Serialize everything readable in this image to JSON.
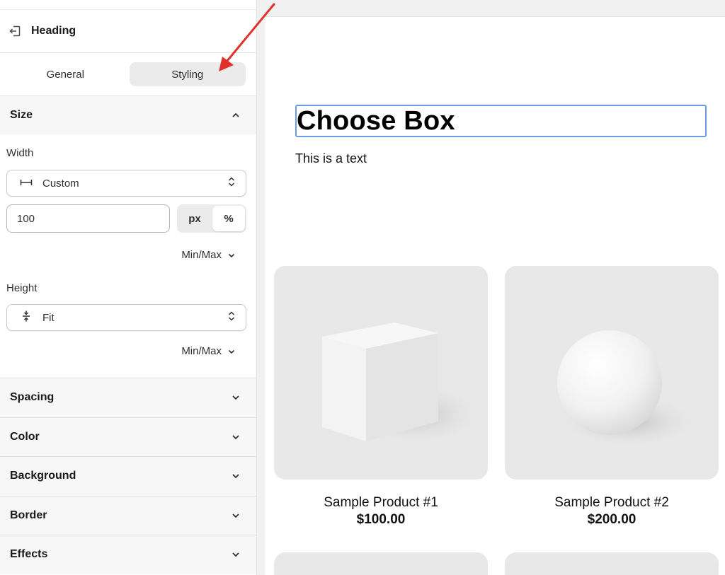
{
  "panel": {
    "title": "Heading",
    "tabs": [
      {
        "label": "General",
        "active": false
      },
      {
        "label": "Styling",
        "active": true
      }
    ],
    "size_section": {
      "title": "Size",
      "width_label": "Width",
      "width_mode": "Custom",
      "width_value": "100",
      "units": [
        "px",
        "%"
      ],
      "active_unit": "%",
      "width_minmax": "Min/Max",
      "height_label": "Height",
      "height_mode": "Fit",
      "height_minmax": "Min/Max"
    },
    "collapsed_sections": [
      "Spacing",
      "Color",
      "Background",
      "Border",
      "Effects"
    ]
  },
  "canvas": {
    "heading": "Choose Box",
    "text": "This is a text",
    "products": [
      {
        "name": "Sample Product #1",
        "price": "$100.00",
        "image": "cube"
      },
      {
        "name": "Sample Product #2",
        "price": "$200.00",
        "image": "sphere"
      }
    ]
  },
  "colors": {
    "selection_border": "#6b9be0",
    "annotation_arrow": "#e0322b",
    "active_tab_bg": "#ebebeb"
  }
}
